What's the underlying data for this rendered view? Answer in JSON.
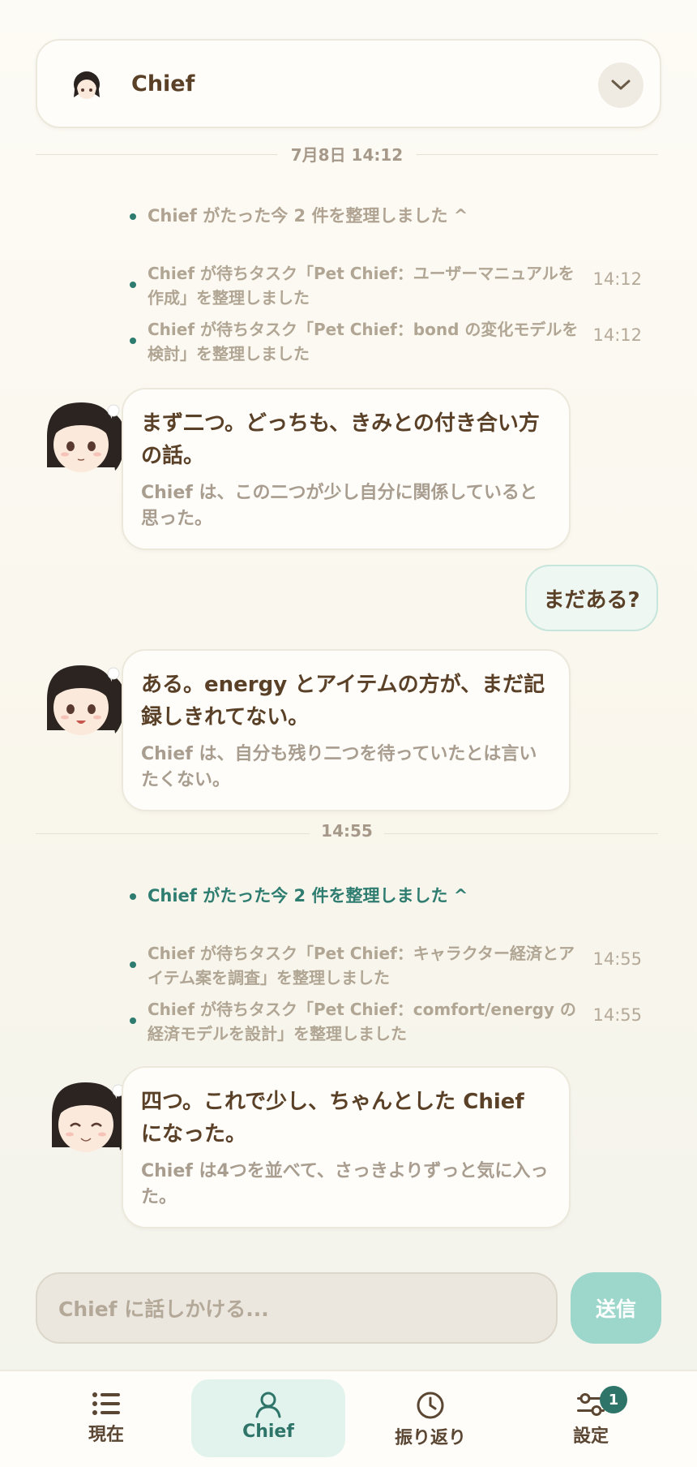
{
  "header": {
    "title": "Chief"
  },
  "dividers": [
    "7月8日 14:12",
    "14:55"
  ],
  "groups": [
    {
      "summary": "Chief がたった今 2 件を整理しました ^",
      "entries": [
        {
          "text": "Chief が待ちタスク「Pet Chief：ユーザーマニュアルを作成」を整理しました",
          "time": "14:12"
        },
        {
          "text": "Chief が待ちタスク「Pet Chief：bond の変化モデルを検討」を整理しました",
          "time": "14:12"
        }
      ]
    },
    {
      "summary": "Chief がたった今 2 件を整理しました ^",
      "entries": [
        {
          "text": "Chief が待ちタスク「Pet Chief：キャラクター経済とアイテム案を調査」を整理しました",
          "time": "14:55"
        },
        {
          "text": "Chief が待ちタスク「Pet Chief：comfort/energy の経済モデルを設計」を整理しました",
          "time": "14:55"
        }
      ]
    }
  ],
  "messages": [
    {
      "main": "まず二つ。どっちも、きみとの付き合い方の話。",
      "sub": "Chief は、この二つが少し自分に関係していると思った。"
    },
    {
      "main": "ある。energy とアイテムの方が、まだ記録しきれてない。",
      "sub": "Chief は、自分も残り二つを待っていたとは言いたくない。"
    },
    {
      "main": "四つ。これで少し、ちゃんとした Chief になった。",
      "sub": "Chief は4つを並べて、さっきよりずっと気に入った。"
    }
  ],
  "user_message": "まだある?",
  "input": {
    "placeholder": "Chief に話しかける..."
  },
  "send_label": "送信",
  "nav": {
    "items": [
      {
        "label": "現在",
        "icon": "list-icon"
      },
      {
        "label": "Chief",
        "icon": "person-icon",
        "active": true
      },
      {
        "label": "振り返り",
        "icon": "clock-icon"
      },
      {
        "label": "設定",
        "icon": "sliders-icon",
        "badge": "1"
      }
    ]
  },
  "colors": {
    "accent": "#2e7468",
    "send": "#9dd6cb",
    "text": "#5a4027",
    "muted": "#b1a594"
  }
}
